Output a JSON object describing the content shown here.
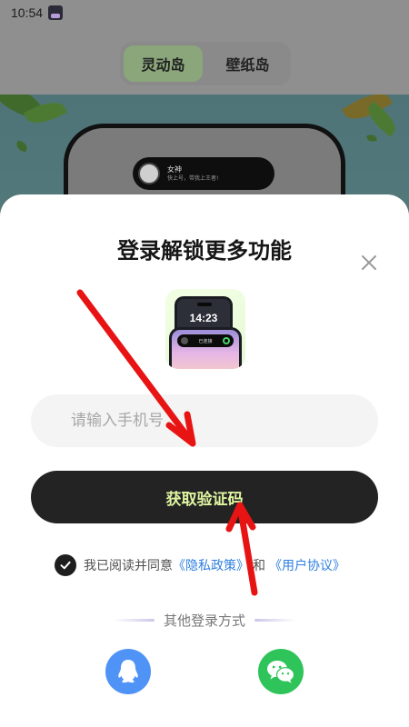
{
  "status_bar": {
    "time": "10:54"
  },
  "background_app": {
    "tabs": [
      {
        "label": "灵动岛",
        "active": true
      },
      {
        "label": "壁纸岛",
        "active": false
      }
    ],
    "island_preview": {
      "name": "女神",
      "message": "快上号，带我上王者!"
    }
  },
  "login_sheet": {
    "title": "登录解锁更多功能",
    "close_icon": "close-icon",
    "preview_time": "14:23",
    "preview_island_label": "已连接",
    "phone_input": {
      "placeholder": "请输入手机号",
      "value": ""
    },
    "get_code_button": "获取验证码",
    "agreement": {
      "checked": true,
      "prefix": "我已阅读并同意",
      "privacy_link": "《隐私政策》",
      "and": "和",
      "user_link": "《用户协议》"
    },
    "other_login": {
      "label": "其他登录方式",
      "methods": [
        {
          "name": "QQ",
          "icon": "qq-icon",
          "color": "#4f93f7"
        },
        {
          "name": "WeChat",
          "icon": "wechat-icon",
          "color": "#2fc45a"
        }
      ]
    }
  },
  "colors": {
    "button_bg": "#232323",
    "button_text": "#dff4a0",
    "link": "#2f7fe0",
    "annotation_arrow": "#e81414"
  }
}
